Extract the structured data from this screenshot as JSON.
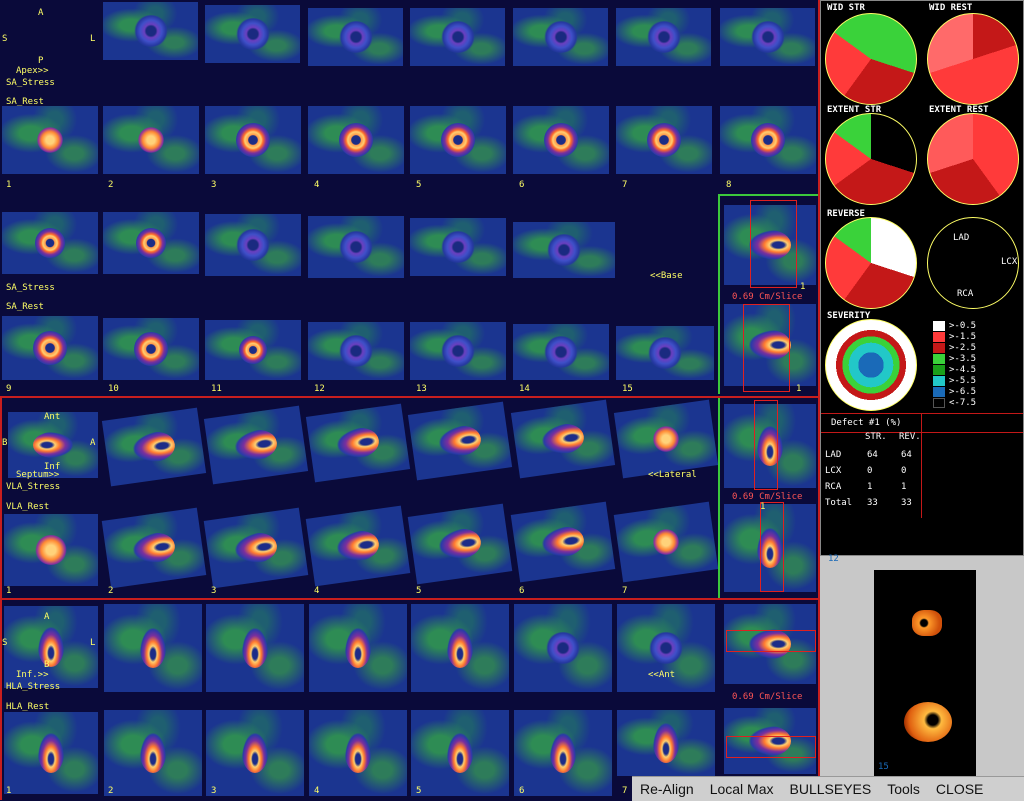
{
  "short_axis": {
    "orient_top": "A",
    "orient_left": "S",
    "orient_right": "L",
    "orient_bottom": "P",
    "apex_label": "Apex>>",
    "stress_label": "SA_Stress",
    "rest_label": "SA_Rest",
    "base_label": "<<Base",
    "slice_thickness": "0.69 Cm/Slice",
    "numbers_row1": [
      "1",
      "2",
      "3",
      "4",
      "5",
      "6",
      "7",
      "8"
    ],
    "numbers_row2": [
      "9",
      "10",
      "11",
      "12",
      "13",
      "14",
      "15"
    ],
    "side_slice_label": "1"
  },
  "vertical_long_axis": {
    "orient_top": "Ant",
    "orient_left": "B",
    "orient_right": "A",
    "orient_bottom": "Inf",
    "septum_label": "Septum>>",
    "stress_label": "VLA_Stress",
    "rest_label": "VLA_Rest",
    "lateral_label": "<<Lateral",
    "slice_thickness": "0.69 Cm/Slice",
    "numbers": [
      "1",
      "2",
      "3",
      "4",
      "5",
      "6",
      "7"
    ],
    "side_slice_label": "1"
  },
  "horizontal_long_axis": {
    "orient_top": "A",
    "orient_left": "S",
    "orient_right": "L",
    "orient_bottom": "B",
    "inf_label": "Inf.>>",
    "stress_label": "HLA_Stress",
    "rest_label": "HLA_Rest",
    "ant_label": "<<Ant",
    "slice_thickness": "0.69 Cm/Slice",
    "numbers": [
      "1",
      "2",
      "3",
      "4",
      "5",
      "6",
      "7"
    ],
    "side_slice_label": "1"
  },
  "bullseyes": {
    "wid_stress": "WID STR",
    "wid_rest": "WID REST",
    "extent_stress": "EXTENT STR",
    "extent_rest": "EXTENT REST",
    "reversibility": "REVERSE",
    "severity": "SEVERITY",
    "territory_lad": "LAD",
    "territory_lcx": "LCX",
    "territory_rca": "RCA"
  },
  "legend": [
    {
      "label": ">-0.5",
      "color": "#ffffff"
    },
    {
      "label": ">-1.5",
      "color": "#ff3a3a"
    },
    {
      "label": ">-2.5",
      "color": "#c41818"
    },
    {
      "label": ">-3.5",
      "color": "#3ad23a"
    },
    {
      "label": ">-4.5",
      "color": "#1aa01a"
    },
    {
      "label": ">-5.5",
      "color": "#22c8c8"
    },
    {
      "label": ">-6.5",
      "color": "#1a6ab8"
    },
    {
      "label": "<-7.5",
      "color": "#000000"
    }
  ],
  "defect_table": {
    "title": "Defect #1 (%)",
    "col_str": "STR.",
    "col_rev": "REV.",
    "rows": [
      {
        "name": "LAD",
        "str": "64",
        "rev": "64"
      },
      {
        "name": "LCX",
        "str": "0",
        "rev": "0"
      },
      {
        "name": "RCA",
        "str": "1",
        "rev": "1"
      },
      {
        "name": "Total",
        "str": "33",
        "rev": "33"
      }
    ]
  },
  "preview": {
    "top_label": "12",
    "bottom_label": "15"
  },
  "menu": {
    "realign": "Re-Align",
    "local_max": "Local Max",
    "bullseyes": "BULLSEYES",
    "tools": "Tools",
    "close": "CLOSE"
  },
  "colors": {
    "background": "#0a0a3a",
    "label_yellow": "#ffff66",
    "divider_red": "#c81e1e",
    "frame_green": "#3cc83c",
    "menu_gray": "#cfcfcf"
  }
}
